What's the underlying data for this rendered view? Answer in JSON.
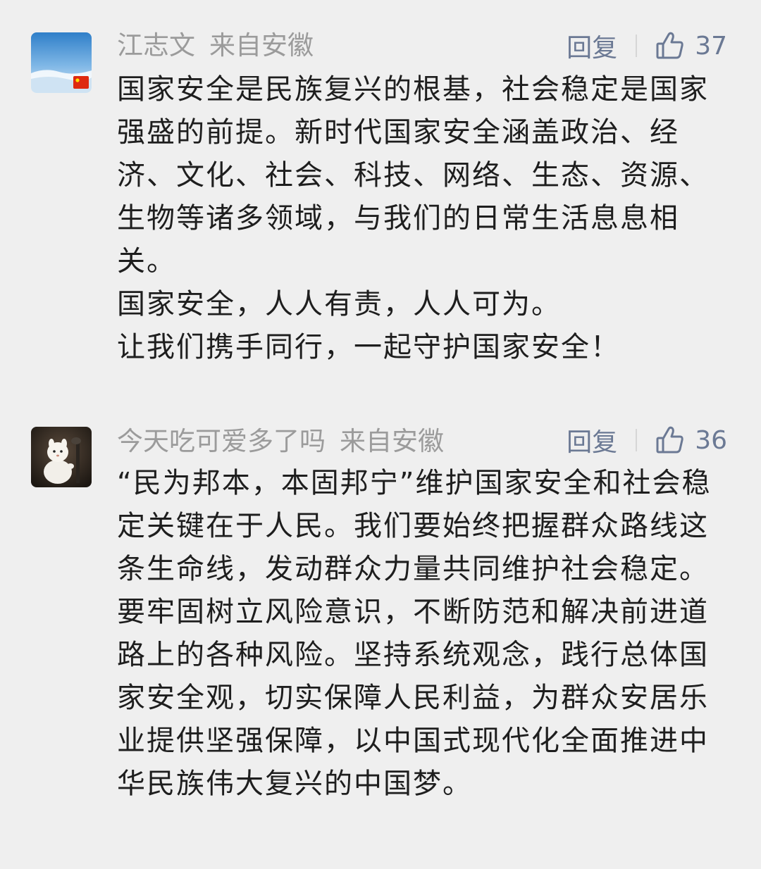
{
  "comments": [
    {
      "author": "江志文",
      "location": "来自安徽",
      "reply_label": "回复",
      "like_count": "37",
      "avatar_icon": "landscape-avatar-icon",
      "badge_icon": "china-flag-badge-icon",
      "paragraphs": [
        "国家安全是民族复兴的根基，社会稳定是国家强盛的前提。新时代国家安全涵盖政治、经济、文化、社会、科技、网络、生态、资源、生物等诸多领域，与我们的日常生活息息相关。",
        "国家安全，人人有责，人人可为。",
        "让我们携手同行，一起守护国家安全！"
      ]
    },
    {
      "author": "今天吃可爱多了吗",
      "location": "来自安徽",
      "reply_label": "回复",
      "like_count": "36",
      "avatar_icon": "snowman-avatar-icon",
      "paragraphs": [
        "“民为邦本，本固邦宁”维护国家安全和社会稳定关键在于人民。我们要始终把握群众路线这条生命线，发动群众力量共同维护社会稳定。要牢固树立风险意识，不断防范和解决前进道路上的各种风险。坚持系统观念，践行总体国家安全观，切实保障人民利益，为群众安居乐业提供坚强保障，以中国式现代化全面推进中华民族伟大复兴的中国梦。"
      ]
    }
  ],
  "colors": {
    "background": "#efefef",
    "meta_text": "#9b9b9b",
    "action_text": "#6b7994",
    "body_text": "#1e1e1e"
  }
}
